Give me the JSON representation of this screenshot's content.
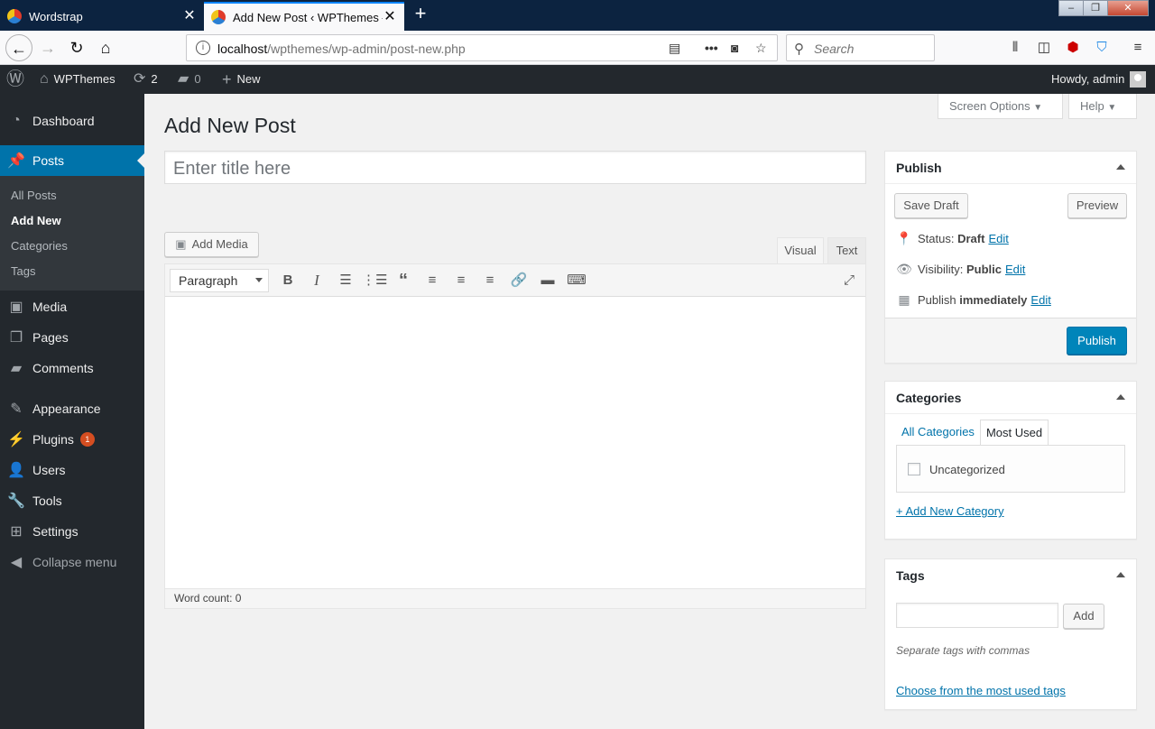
{
  "browser": {
    "tabs": [
      {
        "title": "Wordstrap",
        "active": false
      },
      {
        "title": "Add New Post ‹ WPThemes —",
        "active": true
      }
    ],
    "url_host": "localhost",
    "url_path": "/wpthemes/wp-admin/post-new.php",
    "search_placeholder": "Search"
  },
  "adminbar": {
    "site_name": "WPThemes",
    "updates_count": "2",
    "comments_count": "0",
    "new_label": "New",
    "howdy": "Howdy, admin"
  },
  "sidebar": {
    "items": [
      {
        "label": "Dashboard",
        "icon": "dashboard-icon"
      },
      {
        "label": "Posts",
        "icon": "pin-icon"
      },
      {
        "label": "Media",
        "icon": "media-icon"
      },
      {
        "label": "Pages",
        "icon": "pages-icon"
      },
      {
        "label": "Comments",
        "icon": "comment-icon"
      },
      {
        "label": "Appearance",
        "icon": "brush-icon"
      },
      {
        "label": "Plugins",
        "icon": "plug-icon",
        "badge": "1"
      },
      {
        "label": "Users",
        "icon": "user-icon"
      },
      {
        "label": "Tools",
        "icon": "wrench-icon"
      },
      {
        "label": "Settings",
        "icon": "settings-icon"
      },
      {
        "label": "Collapse menu",
        "icon": "collapse-icon"
      }
    ],
    "submenu": [
      "All Posts",
      "Add New",
      "Categories",
      "Tags"
    ],
    "active_color": "#0073aa",
    "bg_color": "#23282d"
  },
  "screen_options": "Screen Options",
  "help": "Help",
  "page_title": "Add New Post",
  "title_placeholder": "Enter title here",
  "editor": {
    "add_media": "Add Media",
    "tab_visual": "Visual",
    "tab_text": "Text",
    "format_select": "Paragraph",
    "word_count": "Word count: 0"
  },
  "publish": {
    "heading": "Publish",
    "save_draft": "Save Draft",
    "preview": "Preview",
    "status_label": "Status:",
    "status_value": "Draft",
    "visibility_label": "Visibility:",
    "visibility_value": "Public",
    "publish_label": "Publish",
    "publish_value": "immediately",
    "edit": "Edit",
    "publish_button": "Publish",
    "button_color": "#0085ba"
  },
  "categories": {
    "heading": "Categories",
    "tab_all": "All Categories",
    "tab_most_used": "Most Used",
    "items": [
      "Uncategorized"
    ],
    "add_new": "+ Add New Category"
  },
  "tags": {
    "heading": "Tags",
    "add_button": "Add",
    "hint": "Separate tags with commas",
    "choose_link": "Choose from the most used tags"
  }
}
